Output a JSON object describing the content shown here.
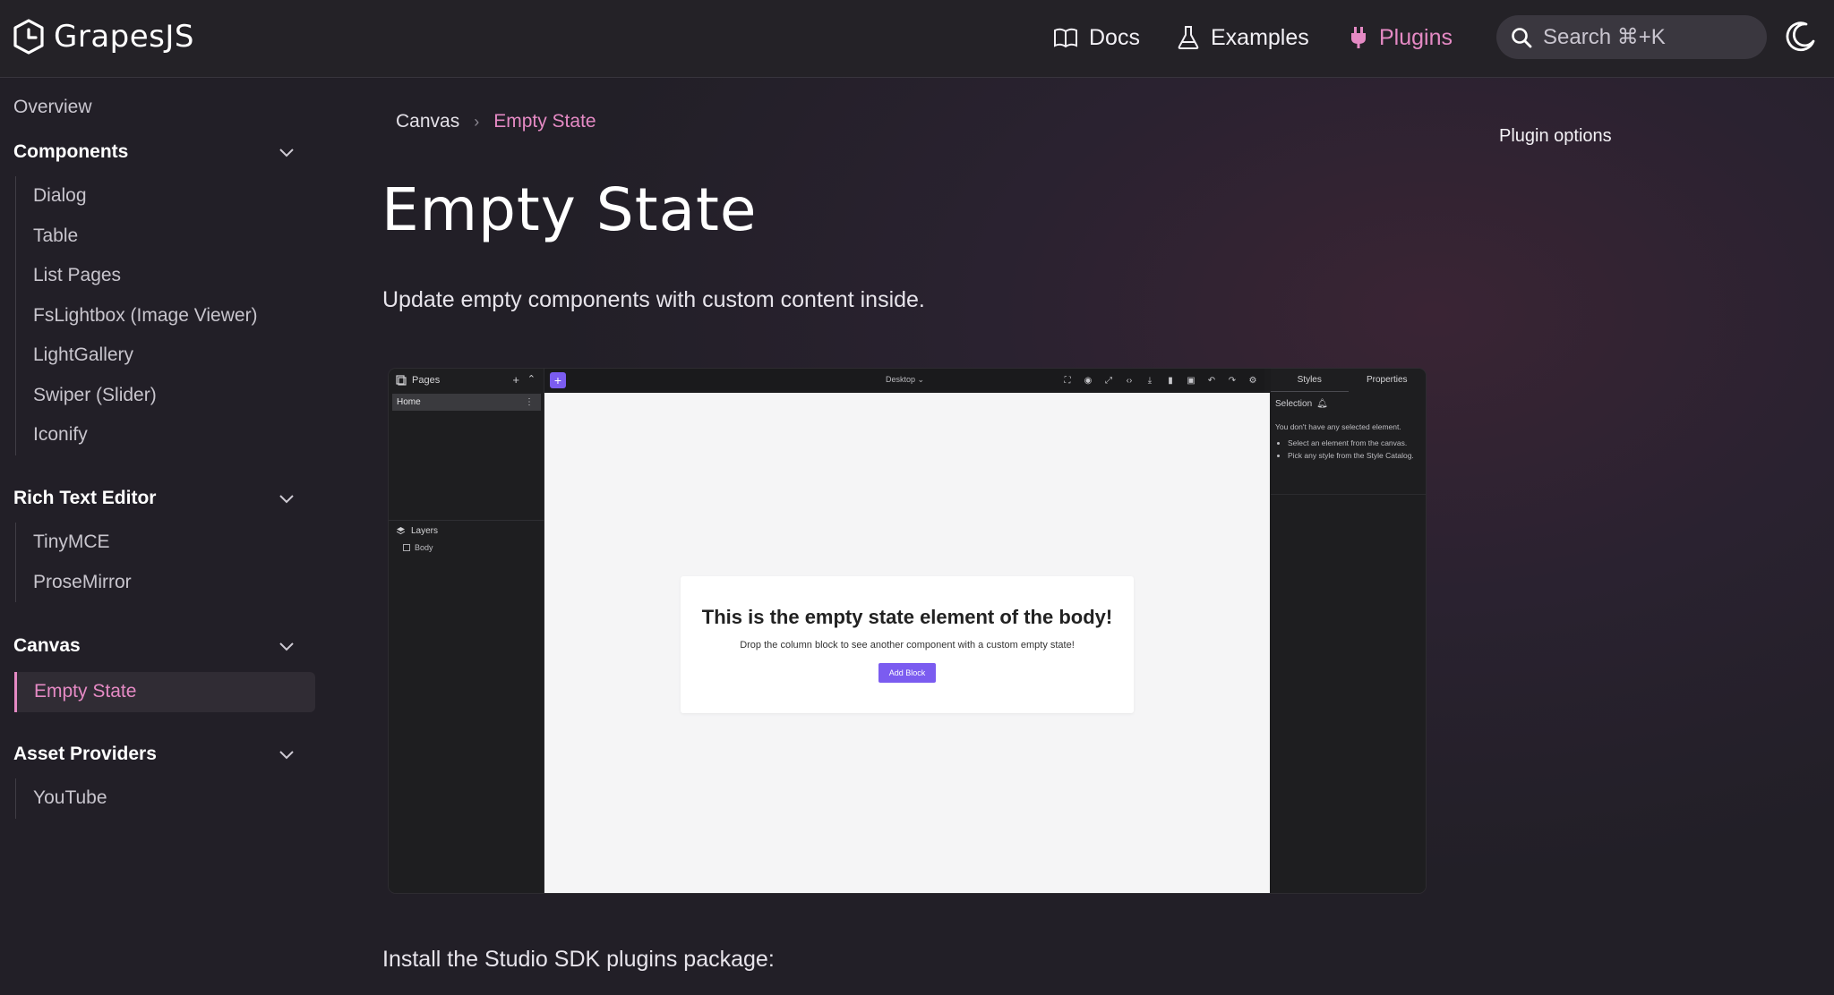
{
  "header": {
    "logo_text": "GrapesJS",
    "nav": [
      {
        "label": "Docs",
        "icon": "book-icon"
      },
      {
        "label": "Examples",
        "icon": "flask-icon"
      },
      {
        "label": "Plugins",
        "icon": "plug-icon"
      }
    ],
    "search_placeholder": "Search ⌘+K",
    "accent_color": "#e58ac4"
  },
  "sidebar": {
    "overview": "Overview",
    "groups": [
      {
        "label": "Components",
        "items": [
          "Dialog",
          "Table",
          "List Pages",
          "FsLightbox (Image Viewer)",
          "LightGallery",
          "Swiper (Slider)",
          "Iconify"
        ]
      },
      {
        "label": "Rich Text Editor",
        "items": [
          "TinyMCE",
          "ProseMirror"
        ]
      },
      {
        "label": "Canvas",
        "items": [
          "Empty State"
        ]
      },
      {
        "label": "Asset Providers",
        "items": [
          "YouTube"
        ]
      }
    ],
    "active_item": "Empty State"
  },
  "main": {
    "breadcrumb": [
      "Canvas",
      "Empty State"
    ],
    "title": "Empty State",
    "description": "Update empty components with custom content inside.",
    "install_text": "Install the Studio SDK plugins package:",
    "toc_title": "Plugin options"
  },
  "editor_screenshot": {
    "pages_label": "Pages",
    "home_page": "Home",
    "layers_label": "Layers",
    "body_layer": "Body",
    "device": "Desktop ⌄",
    "tabs": [
      "Styles",
      "Properties"
    ],
    "selection_label": "Selection",
    "no_selection_text": "You don't have any selected element.",
    "hints": [
      "Select an element from the canvas.",
      "Pick any style from the Style Catalog."
    ],
    "empty_title": "This is the empty state element of the body!",
    "empty_subtitle": "Drop the column block to see another component with a custom empty state!",
    "add_block_label": "Add Block",
    "accent_color": "#7b5cf0"
  }
}
